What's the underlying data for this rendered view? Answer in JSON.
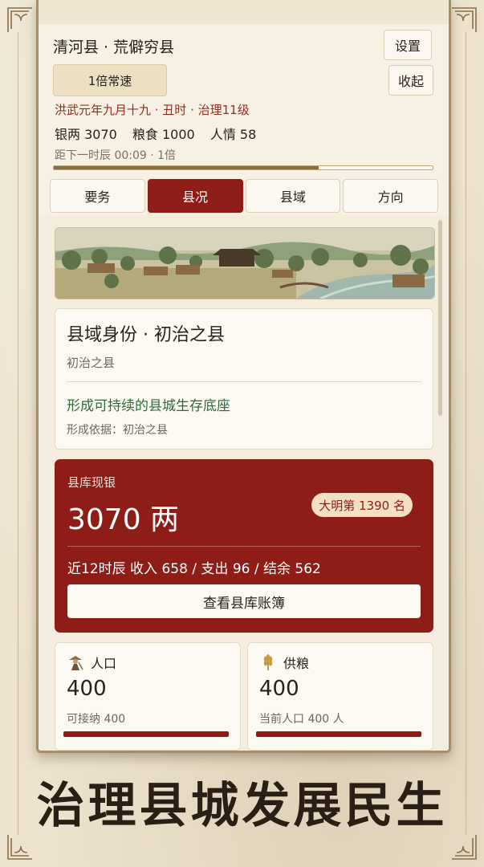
{
  "header": {
    "title": "清河县 · 荒僻穷县",
    "settings_label": "设置",
    "collapse_label": "收起",
    "speed_label": "1倍常速",
    "date_line": "洪武元年九月十九 · 丑时 · 治理11级",
    "resources": {
      "silver": "银两 3070",
      "grain": "粮食 1000",
      "sentiment": "人情 58"
    },
    "timer": "距下一时辰 00:09 · 1倍",
    "progress": 0.7
  },
  "tabs": [
    {
      "label": "要务",
      "active": false
    },
    {
      "label": "县况",
      "active": true
    },
    {
      "label": "县域",
      "active": false
    },
    {
      "label": "方向",
      "active": false
    }
  ],
  "identity": {
    "title": "县域身份 · 初治之县",
    "subtitle": "初治之县",
    "goal": "形成可持续的县城生存底座",
    "basis": "形成依据：初治之县"
  },
  "treasury": {
    "label": "县库现银",
    "amount": "3070 两",
    "rank": "大明第 1390 名",
    "summary": "近12时辰 收入 658 / 支出 96 / 结余 562",
    "ledger_button": "查看县库账簿"
  },
  "stats": {
    "population": {
      "label": "人口",
      "value": "400",
      "sub": "可接纳 400",
      "fill": 1.0,
      "icon": "farmer-icon"
    },
    "grain": {
      "label": "供粮",
      "value": "400",
      "sub": "当前人口 400 人",
      "fill": 1.0,
      "icon": "wheat-icon"
    }
  },
  "slogan": "治理县城发展民生",
  "colors": {
    "accent": "#8e1d17",
    "green": "#2f6b3a",
    "date_red": "#9b2a1f",
    "progress": "#8c6b3d"
  }
}
